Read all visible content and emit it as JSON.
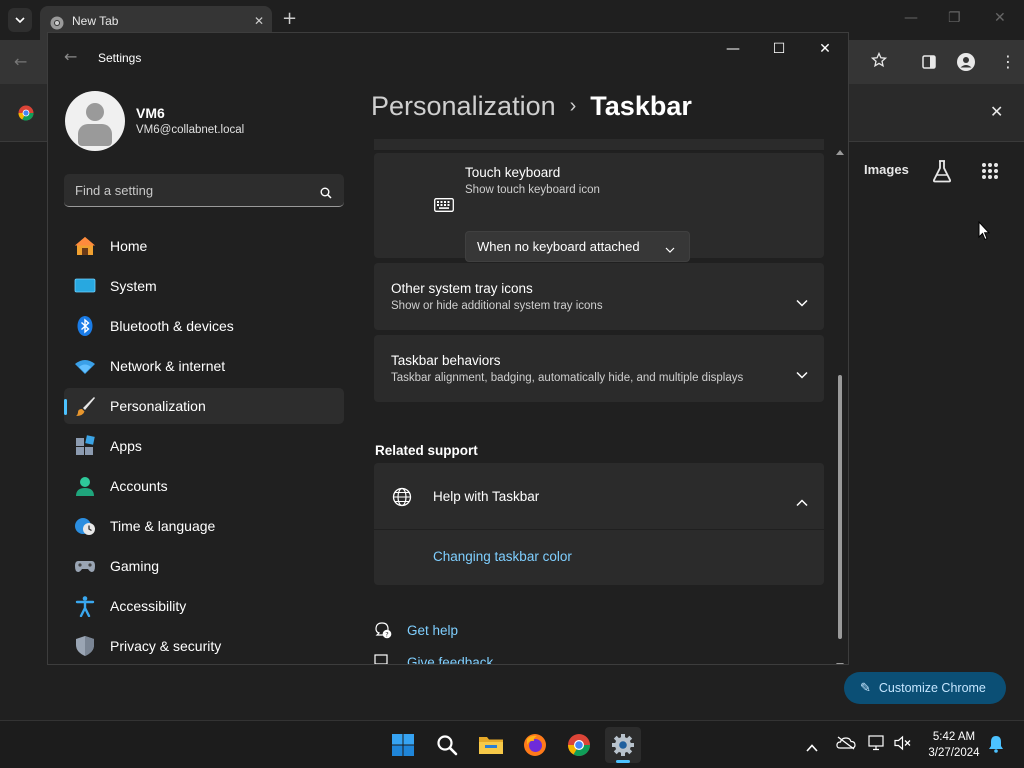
{
  "chrome": {
    "tab_title": "New Tab",
    "ntp_images_link": "Images",
    "customize_button": "Customize Chrome"
  },
  "settings": {
    "window_title": "Settings",
    "profile": {
      "name": "VM6",
      "email": "VM6@collabnet.local"
    },
    "search_placeholder": "Find a setting",
    "nav": [
      {
        "label": "Home",
        "icon": "home-icon"
      },
      {
        "label": "System",
        "icon": "system-icon"
      },
      {
        "label": "Bluetooth & devices",
        "icon": "bluetooth-icon"
      },
      {
        "label": "Network & internet",
        "icon": "wifi-icon"
      },
      {
        "label": "Personalization",
        "icon": "brush-icon",
        "selected": true
      },
      {
        "label": "Apps",
        "icon": "apps-icon"
      },
      {
        "label": "Accounts",
        "icon": "account-icon"
      },
      {
        "label": "Time & language",
        "icon": "globe-clock-icon"
      },
      {
        "label": "Gaming",
        "icon": "gamepad-icon"
      },
      {
        "label": "Accessibility",
        "icon": "accessibility-icon"
      },
      {
        "label": "Privacy & security",
        "icon": "shield-icon"
      }
    ],
    "breadcrumb": {
      "parent": "Personalization",
      "current": "Taskbar"
    },
    "touch_keyboard": {
      "title": "Touch keyboard",
      "subtitle": "Show touch keyboard icon",
      "dropdown_value": "When no keyboard attached"
    },
    "other_tray": {
      "title": "Other system tray icons",
      "subtitle": "Show or hide additional system tray icons"
    },
    "behaviors": {
      "title": "Taskbar behaviors",
      "subtitle": "Taskbar alignment, badging, automatically hide, and multiple displays"
    },
    "related_support": {
      "heading": "Related support",
      "help_title": "Help with Taskbar",
      "help_link": "Changing taskbar color"
    },
    "get_help": "Get help",
    "give_feedback": "Give feedback"
  },
  "taskbar": {
    "time": "5:42 AM",
    "date": "3/27/2024",
    "apps": [
      "start-icon",
      "search-icon",
      "file-explorer-icon",
      "firefox-icon",
      "chrome-icon",
      "settings-icon"
    ]
  },
  "colors": {
    "accent": "#4cc2ff",
    "link": "#7fcfff",
    "window_bg": "#202020",
    "card_bg": "#2b2b2b"
  }
}
